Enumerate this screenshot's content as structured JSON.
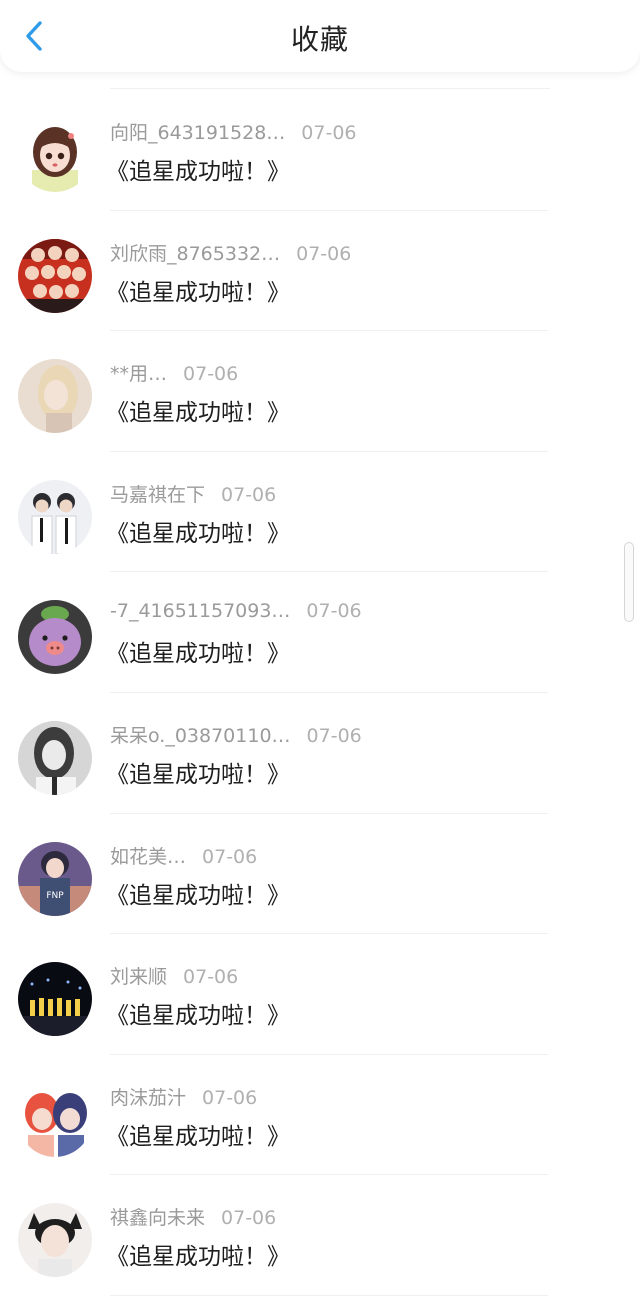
{
  "header": {
    "title": "收藏",
    "back_icon": "chevron-left-icon",
    "accent_color": "#2f9be8"
  },
  "items": [
    {
      "user": "向阳_643191528…",
      "date": "07-06",
      "title": "《追星成功啦！》",
      "avatar": "cartoon-girl-avatar"
    },
    {
      "user": "刘欣雨_8765332…",
      "date": "07-06",
      "title": "《追星成功啦！》",
      "avatar": "group-photo-avatar"
    },
    {
      "user": "**用…",
      "date": "07-06",
      "title": "《追星成功啦！》",
      "avatar": "blonde-girl-avatar"
    },
    {
      "user": "马嘉祺在下",
      "date": "07-06",
      "title": "《追星成功啦！》",
      "avatar": "two-singers-avatar"
    },
    {
      "user": "-7_41651157093…",
      "date": "07-06",
      "title": "《追星成功啦！》",
      "avatar": "purple-plush-avatar"
    },
    {
      "user": "呆呆o._03870110…",
      "date": "07-06",
      "title": "《追星成功啦！》",
      "avatar": "grey-girl-avatar"
    },
    {
      "user": "如花美…",
      "date": "07-06",
      "title": "《追星成功啦！》",
      "avatar": "anime-boy-avatar"
    },
    {
      "user": "刘来顺",
      "date": "07-06",
      "title": "《追星成功啦！》",
      "avatar": "stage-concert-avatar"
    },
    {
      "user": "肉沫茄汁",
      "date": "07-06",
      "title": "《追星成功啦！》",
      "avatar": "anime-couple-avatar"
    },
    {
      "user": "祺鑫向未来",
      "date": "07-06",
      "title": "《追星成功啦！》",
      "avatar": "boy-cat-ears-avatar"
    }
  ]
}
